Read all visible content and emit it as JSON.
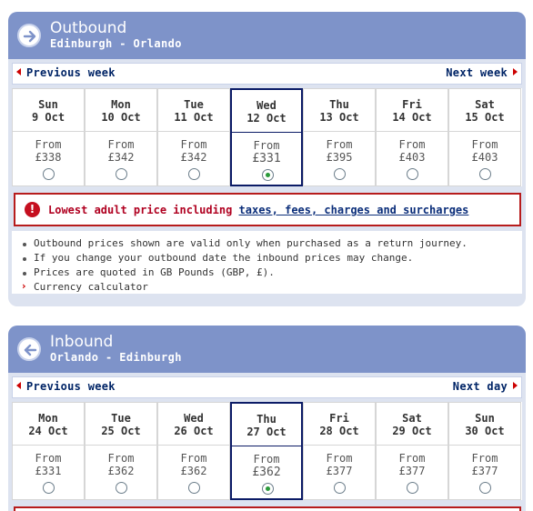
{
  "colors": {
    "header": "#7e93c9",
    "panel_bg": "#dde3f0",
    "selected_border": "#0b1b66",
    "alert_red": "#b71c1c",
    "radio_selected": "#2a9a3a"
  },
  "outbound": {
    "title": "Outbound",
    "route": "Edinburgh - Orlando",
    "icon": "right-arrow-icon",
    "prev_label": "Previous week",
    "next_label": "Next week",
    "days": [
      {
        "day": "Sun",
        "date": "9 Oct",
        "from": "From",
        "price": "£338",
        "selected": false
      },
      {
        "day": "Mon",
        "date": "10 Oct",
        "from": "From",
        "price": "£342",
        "selected": false
      },
      {
        "day": "Tue",
        "date": "11 Oct",
        "from": "From",
        "price": "£342",
        "selected": false
      },
      {
        "day": "Wed",
        "date": "12 Oct",
        "from": "From",
        "price": "£331",
        "selected": true
      },
      {
        "day": "Thu",
        "date": "13 Oct",
        "from": "From",
        "price": "£395",
        "selected": false
      },
      {
        "day": "Fri",
        "date": "14 Oct",
        "from": "From",
        "price": "£403",
        "selected": false
      },
      {
        "day": "Sat",
        "date": "15 Oct",
        "from": "From",
        "price": "£403",
        "selected": false
      }
    ],
    "notice_text": "Lowest adult price including ",
    "notice_link": "taxes, fees, charges and surcharges",
    "info": [
      "Outbound prices shown are valid only when purchased as a return journey.",
      "If you change your outbound date the inbound prices may change.",
      "Prices are quoted in GB Pounds (GBP, £)."
    ],
    "calculator_label": "Currency calculator"
  },
  "inbound": {
    "title": "Inbound",
    "route": "Orlando - Edinburgh",
    "icon": "left-arrow-icon",
    "prev_label": "Previous week",
    "next_label": "Next day",
    "days": [
      {
        "day": "Mon",
        "date": "24 Oct",
        "from": "From",
        "price": "£331",
        "selected": false
      },
      {
        "day": "Tue",
        "date": "25 Oct",
        "from": "From",
        "price": "£362",
        "selected": false
      },
      {
        "day": "Wed",
        "date": "26 Oct",
        "from": "From",
        "price": "£362",
        "selected": false
      },
      {
        "day": "Thu",
        "date": "27 Oct",
        "from": "From",
        "price": "£362",
        "selected": true
      },
      {
        "day": "Fri",
        "date": "28 Oct",
        "from": "From",
        "price": "£377",
        "selected": false
      },
      {
        "day": "Sat",
        "date": "29 Oct",
        "from": "From",
        "price": "£377",
        "selected": false
      },
      {
        "day": "Sun",
        "date": "30 Oct",
        "from": "From",
        "price": "£377",
        "selected": false
      }
    ]
  }
}
